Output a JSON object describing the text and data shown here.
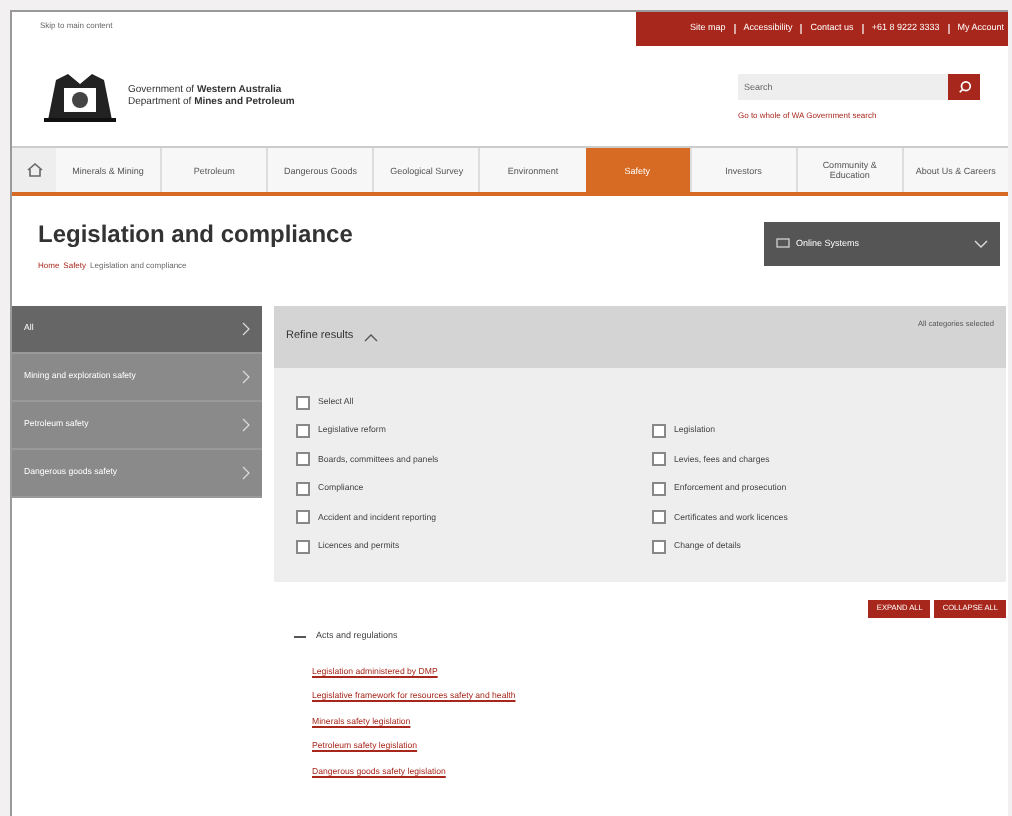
{
  "skip_link": "Skip to main content",
  "utility_links": [
    "Site map",
    "Accessibility",
    "Contact us",
    "+61 8 9222 3333",
    "My Account"
  ],
  "brand": {
    "line_1": "Government of **Western Australia**",
    "line_2": "Department of **Mines and Petroleum**"
  },
  "search": {
    "placeholder": "Search",
    "link": "Go to whole of WA Government search"
  },
  "nav": [
    {
      "label": "Minerals & Mining",
      "selected": false
    },
    {
      "label": "Petroleum",
      "selected": false
    },
    {
      "label": "Dangerous Goods",
      "selected": false
    },
    {
      "label": "Geological Survey",
      "selected": false
    },
    {
      "label": "Environment",
      "selected": false
    },
    {
      "label": "Safety",
      "selected": true
    },
    {
      "label": "Investors",
      "selected": false
    },
    {
      "label": "Community & Education",
      "selected": false
    },
    {
      "label": "About Us & Careers",
      "selected": false
    }
  ],
  "page_title": "Legislation and compliance",
  "breadcrumb": [
    "Home",
    "Safety",
    "Legislation and compliance"
  ],
  "online_systems": "Online Systems",
  "sidebar": [
    {
      "label": "All",
      "selected": true
    },
    {
      "label": "Mining and exploration safety",
      "selected": false
    },
    {
      "label": "Petroleum safety",
      "selected": false
    },
    {
      "label": "Dangerous goods safety",
      "selected": false
    }
  ],
  "refine": {
    "title": "Refine results",
    "status": "All categories selected",
    "select_all": {
      "label": "Select All",
      "checked": false
    },
    "options": [
      {
        "label": "Legislative reform",
        "checked": false
      },
      {
        "label": "Legislation",
        "checked": false
      },
      {
        "label": "Boards, committees and panels",
        "checked": false
      },
      {
        "label": "Levies, fees and charges",
        "checked": false
      },
      {
        "label": "Compliance",
        "checked": false
      },
      {
        "label": "Enforcement and prosecution",
        "checked": false
      },
      {
        "label": "Accident and incident reporting",
        "checked": false
      },
      {
        "label": "Certificates and work licences",
        "checked": false
      },
      {
        "label": "Licences and permits",
        "checked": false
      },
      {
        "label": "Change of details",
        "checked": false
      }
    ]
  },
  "buttons": [
    "EXPAND ALL",
    "COLLAPSE ALL"
  ],
  "section": {
    "title": "Acts and regulations",
    "expanded": true,
    "links": [
      "Legislation administered by DMP",
      "Legislative framework for resources safety and health",
      "Minerals safety legislation",
      "Petroleum safety legislation",
      "Dangerous goods safety legislation"
    ]
  }
}
